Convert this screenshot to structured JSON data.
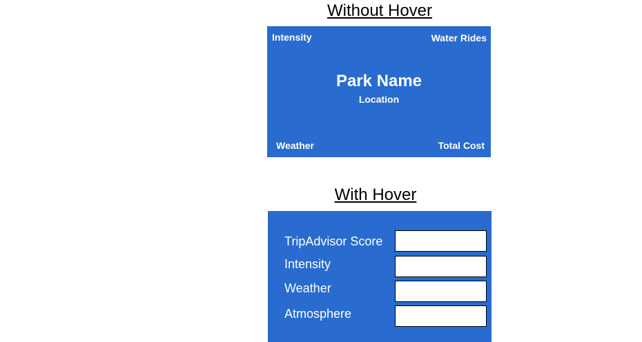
{
  "titles": {
    "without_hover": "Without Hover",
    "with_hover": "With Hover"
  },
  "card_without_hover": {
    "top_left": "Intensity",
    "top_right": "Water Rides",
    "name": "Park Name",
    "location": "Location",
    "bottom_left": "Weather",
    "bottom_right": "Total Cost"
  },
  "card_with_hover": {
    "rows": [
      {
        "label": "TripAdvisor Score",
        "value": ""
      },
      {
        "label": "Intensity",
        "value": ""
      },
      {
        "label": "Weather",
        "value": ""
      },
      {
        "label": "Atmosphere",
        "value": ""
      }
    ]
  },
  "colors": {
    "card_background": "#296bcf",
    "card_text": "#ffffff",
    "value_box": "#ffffff"
  }
}
